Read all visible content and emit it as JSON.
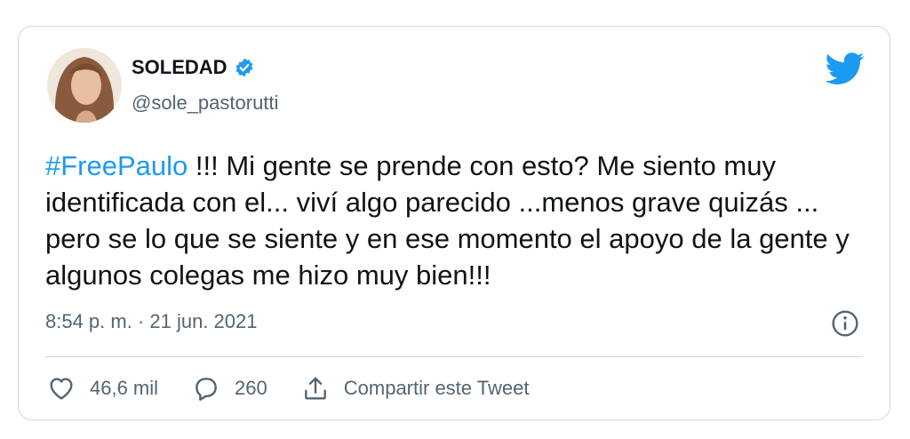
{
  "tweet": {
    "display_name": "SOLEDAD",
    "handle": "@sole_pastorutti",
    "hashtag": "#FreePaulo",
    "text_rest": " !!! Mi gente se prende con esto? Me siento muy identificada con el... viví algo parecido ...menos grave quizás ... pero se lo que se siente y en ese momento el apoyo de la gente y algunos colegas me hizo muy bien!!!",
    "timestamp": "8:54 p. m. · 21 jun. 2021",
    "likes": "46,6 mil",
    "replies": "260",
    "share_label": "Compartir este Tweet"
  },
  "colors": {
    "brand_blue": "#1d9bf0",
    "text_primary": "#0f1419",
    "text_secondary": "#536471",
    "border": "#cfd9de"
  },
  "icons": [
    "verified-badge-icon",
    "twitter-bird-icon",
    "info-icon",
    "heart-icon",
    "reply-icon",
    "share-icon"
  ]
}
